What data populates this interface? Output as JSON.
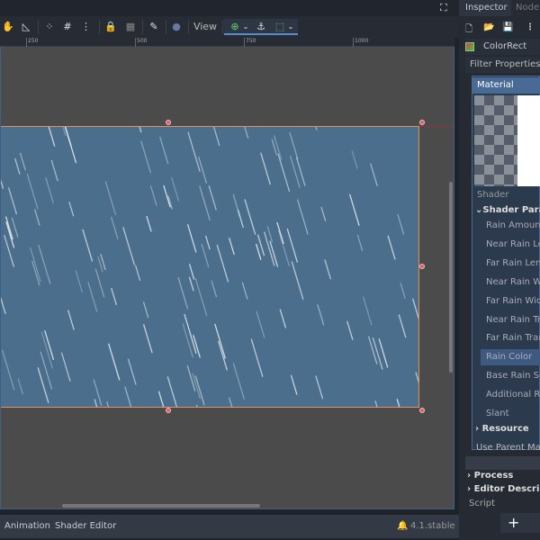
{
  "toolbar": {
    "view_label": "View"
  },
  "ruler": {
    "ticks": [
      "250",
      "500",
      "750",
      "1000"
    ]
  },
  "bottom_panel": {
    "tabs": [
      "Animation",
      "Shader Editor"
    ],
    "version": "4.1.stable"
  },
  "inspector": {
    "tabs": [
      "Inspector",
      "Node"
    ],
    "node_name": "ColorRect",
    "filter_placeholder": "Filter Properties",
    "material_label": "Material",
    "shader_label": "Shader",
    "shader_params_label": "Shader Param",
    "params": [
      "Rain Amount",
      "Near Rain Len",
      "Far Rain Leng",
      "Near Rain Wid",
      "Far Rain Width",
      "Near Rain Tra",
      "Far Rain Trans",
      "Rain Color",
      "Base Rain Spe",
      "Additional Rai",
      "Slant"
    ],
    "selected_param": "Rain Color",
    "resource_label": "Resource",
    "use_parent_label": "Use Parent Mate",
    "process_label": "Process",
    "editor_desc_label": "Editor Descripti",
    "script_label": "Script",
    "add_label": "+"
  },
  "colors": {
    "rect": "#4a6e8c",
    "selection": "#e0905c",
    "accent": "#4a7ab0"
  }
}
